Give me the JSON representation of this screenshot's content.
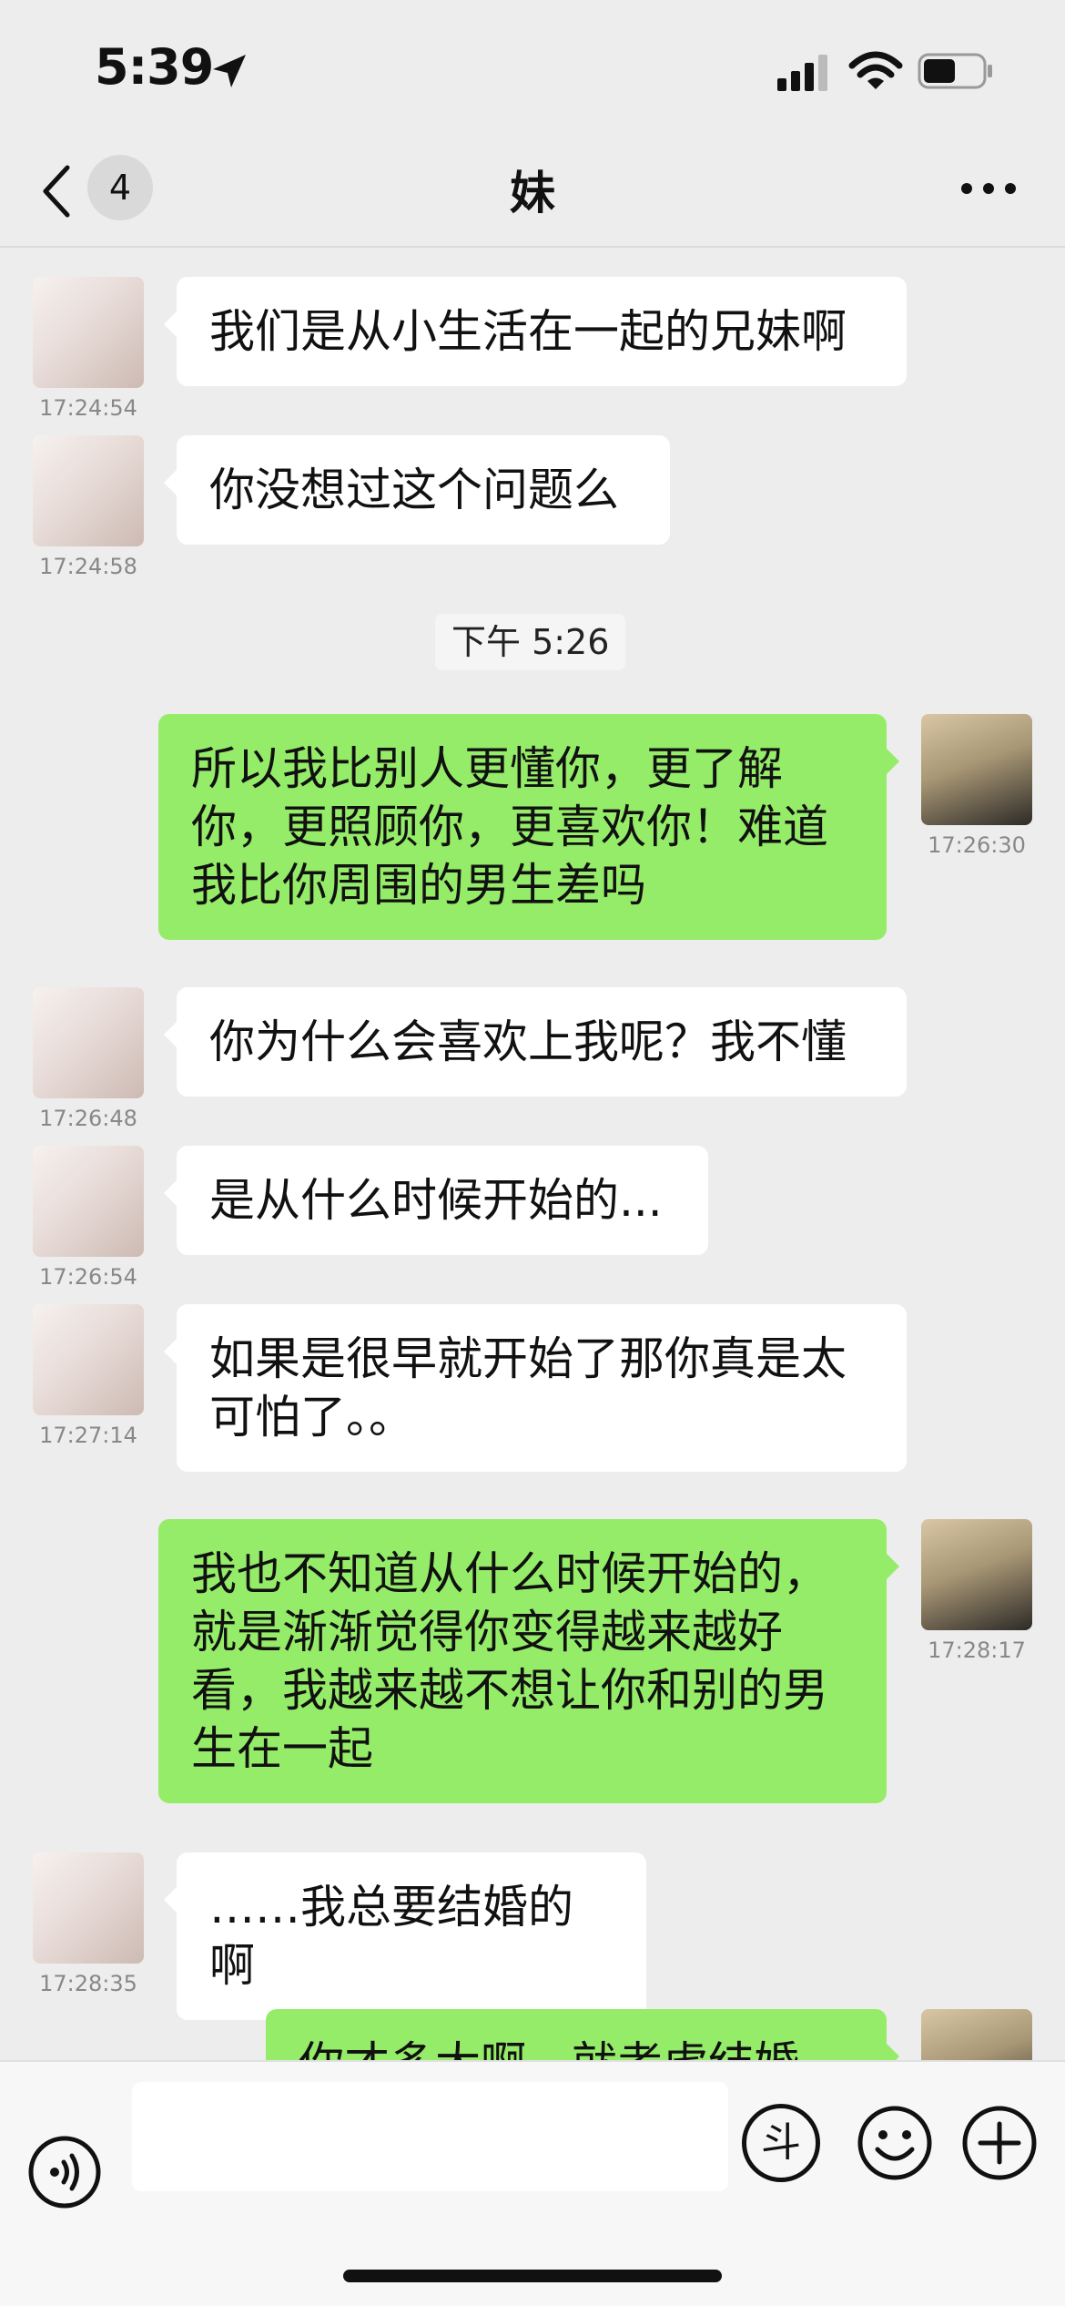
{
  "status_bar": {
    "time": "5:39",
    "icons": [
      "location-arrow-icon",
      "cellular-signal-icon",
      "wifi-icon",
      "battery-icon"
    ]
  },
  "nav": {
    "back_icon": "chevron-left-icon",
    "unread_count": "4",
    "title": "妹",
    "more_icon": "ellipsis-icon"
  },
  "messages": [
    {
      "from": "in",
      "text": "我们是从小生活在一起的兄妹啊",
      "time": "17:24:54"
    },
    {
      "from": "in",
      "text": "你没想过这个问题么",
      "time": "17:24:58"
    },
    {
      "divider": "下午 5:26"
    },
    {
      "from": "out",
      "text": "所以我比别人更懂你，更了解你，更照顾你，更喜欢你！难道我比你周围的男生差吗",
      "time": "17:26:30"
    },
    {
      "from": "in",
      "text": "你为什么会喜欢上我呢？我不懂",
      "time": "17:26:48"
    },
    {
      "from": "in",
      "text": "是从什么时候开始的...",
      "time": "17:26:54"
    },
    {
      "from": "in",
      "text": "如果是很早就开始了那你真是太可怕了。。",
      "time": "17:27:14"
    },
    {
      "from": "out",
      "text": "我也不知道从什么时候开始的，就是渐渐觉得你变得越来越好看，我越来越不想让你和别的男生在一起",
      "time": "17:28:17"
    },
    {
      "from": "in",
      "text": "……我总要结婚的啊",
      "time": "17:28:35"
    },
    {
      "from": "out",
      "text": "你才多大啊，就考虑结婚",
      "time": ""
    }
  ],
  "input_bar": {
    "voice_icon": "voice-icon",
    "input_value": "",
    "douyin_label": "斗",
    "emoji_icon": "emoji-icon",
    "plus_icon": "plus-icon"
  },
  "colors": {
    "background": "#ededed",
    "outgoing_bubble": "#95ec69",
    "incoming_bubble": "#ffffff",
    "timestamp": "#888888"
  }
}
